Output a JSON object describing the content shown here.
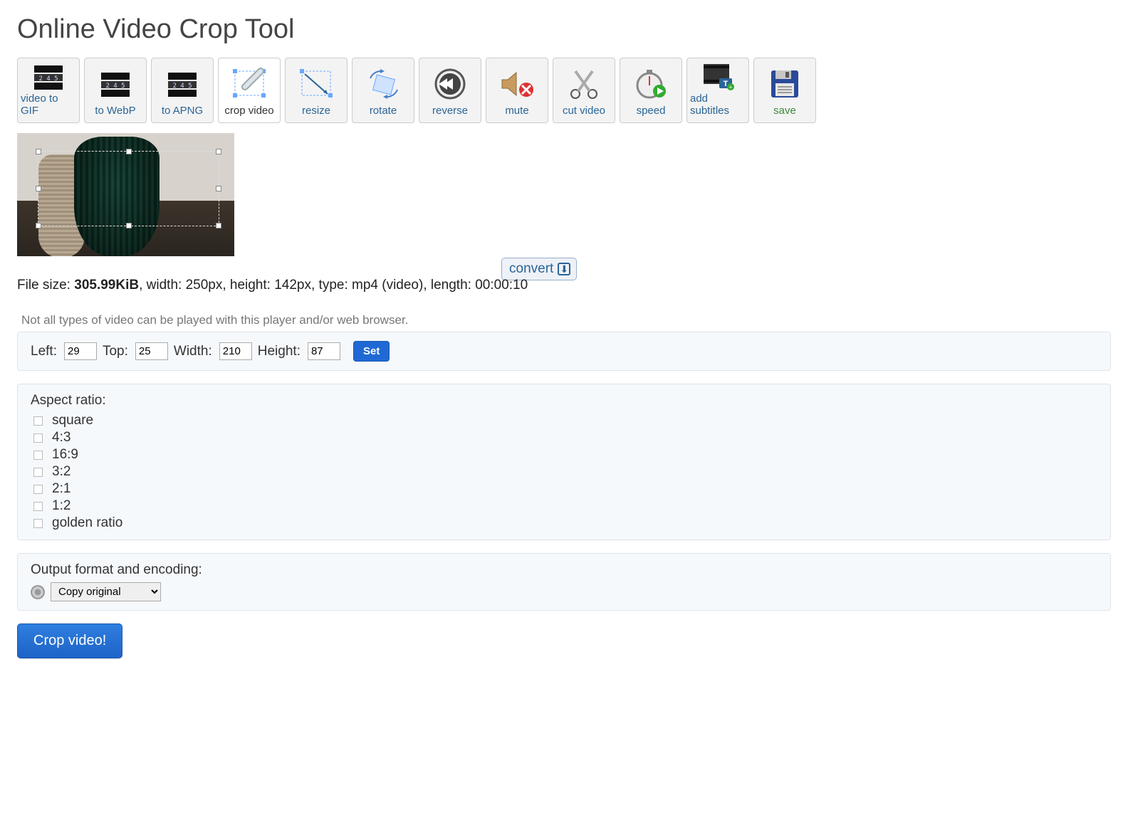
{
  "title": "Online Video Crop Tool",
  "toolbar": [
    {
      "id": "video-to-gif",
      "label": "video to GIF"
    },
    {
      "id": "to-webp",
      "label": "to WebP"
    },
    {
      "id": "to-apng",
      "label": "to APNG"
    },
    {
      "id": "crop-video",
      "label": "crop video",
      "active": true
    },
    {
      "id": "resize",
      "label": "resize"
    },
    {
      "id": "rotate",
      "label": "rotate"
    },
    {
      "id": "reverse",
      "label": "reverse"
    },
    {
      "id": "mute",
      "label": "mute"
    },
    {
      "id": "cut-video",
      "label": "cut video"
    },
    {
      "id": "speed",
      "label": "speed"
    },
    {
      "id": "add-subtitles",
      "label": "add subtitles"
    },
    {
      "id": "save",
      "label": "save"
    }
  ],
  "convert_label": "convert",
  "file_info": {
    "prefix": "File size: ",
    "size": "305.99KiB",
    "rest": ", width: 250px, height: 142px, type: mp4 (video), length: 00:00:10"
  },
  "note": "Not all types of video can be played with this player and/or web browser.",
  "coords": {
    "left_label": "Left:",
    "left": "29",
    "top_label": "Top:",
    "top": "25",
    "width_label": "Width:",
    "width": "210",
    "height_label": "Height:",
    "height": "87",
    "set_label": "Set"
  },
  "ratio": {
    "title": "Aspect ratio:",
    "options": [
      "square",
      "4:3",
      "16:9",
      "3:2",
      "2:1",
      "1:2",
      "golden ratio"
    ]
  },
  "encoding": {
    "title": "Output format and encoding:",
    "selected": "Copy original"
  },
  "crop_button": "Crop video!"
}
